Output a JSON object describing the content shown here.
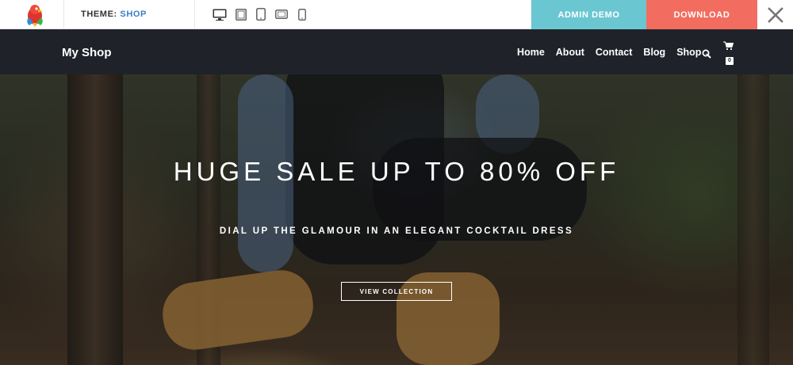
{
  "demo_bar": {
    "theme_prefix": "THEME:",
    "theme_value": "SHOP",
    "devices": [
      "desktop-icon",
      "laptop-icon",
      "tablet-icon",
      "tablet-landscape-icon",
      "mobile-icon"
    ],
    "admin_label": "ADMIN DEMO",
    "download_label": "DOWNLOAD",
    "colors": {
      "admin": "#6ac7d1",
      "download": "#f26d5f",
      "theme_value": "#3a7dc9"
    }
  },
  "nav": {
    "brand": "My Shop",
    "items": [
      "Home",
      "About",
      "Contact",
      "Blog",
      "Shop"
    ],
    "cart_count": "0"
  },
  "hero": {
    "title": "HUGE SALE UP TO 80% OFF",
    "subtitle": "DIAL UP THE GLAMOUR IN AN ELEGANT COCKTAIL DRESS",
    "button": "VIEW COLLECTION"
  }
}
